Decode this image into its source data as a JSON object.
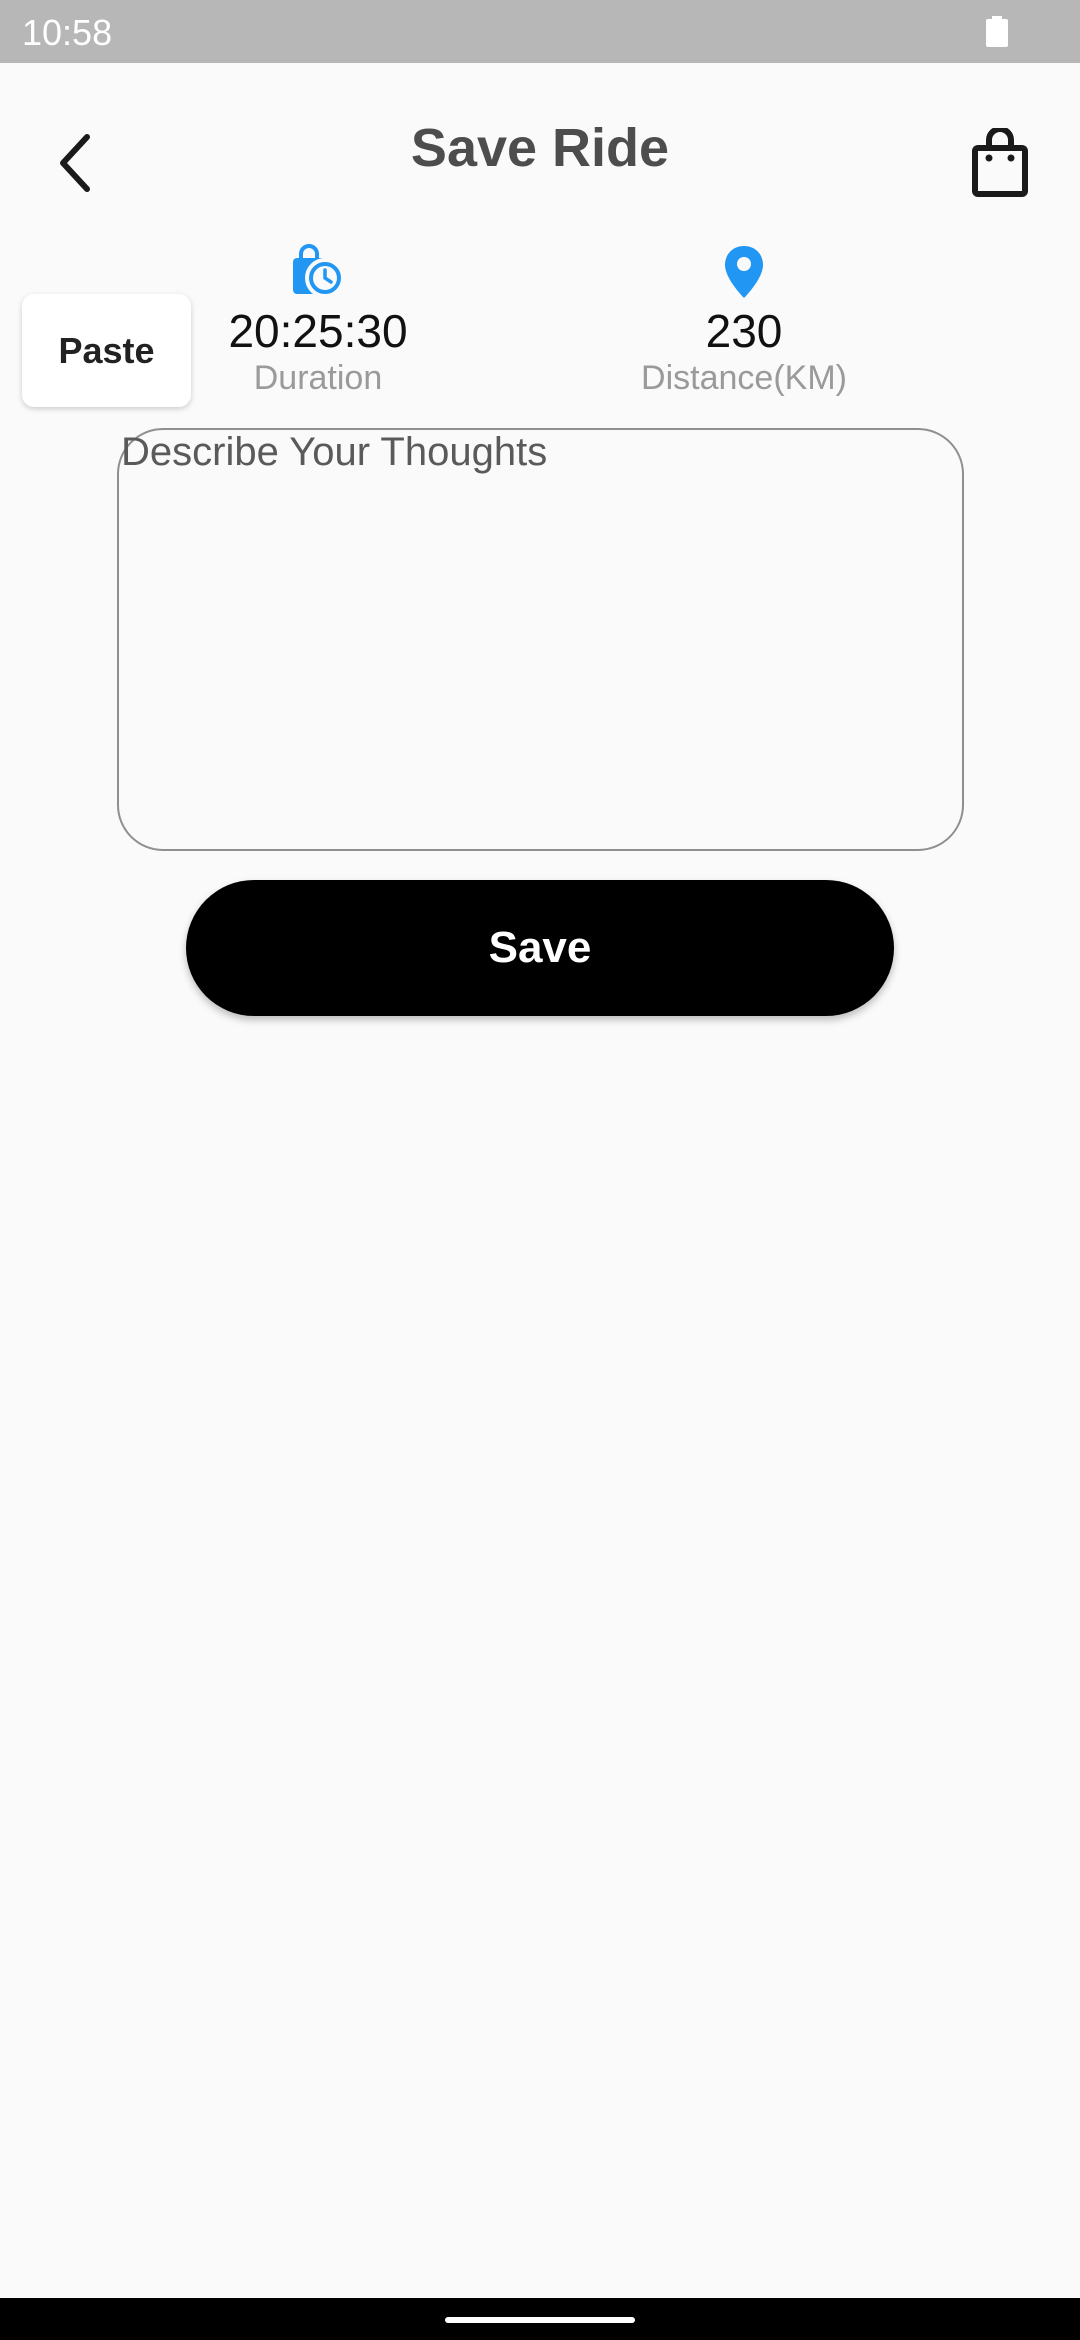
{
  "status_bar": {
    "time": "10:58",
    "battery_icon": "battery-full-icon"
  },
  "header": {
    "title": "Save Ride",
    "back_icon": "chevron-left-icon",
    "bag_icon": "shopping-bag-icon"
  },
  "toolbar": {
    "paste_label": "Paste"
  },
  "stats": {
    "duration": {
      "value": "20:25:30",
      "label": "Duration",
      "icon": "clock-bag-icon"
    },
    "distance": {
      "value": "230",
      "label": "Distance(KM)",
      "icon": "location-pin-icon"
    }
  },
  "thoughts": {
    "placeholder": "Describe Your Thoughts",
    "value": ""
  },
  "actions": {
    "save_label": "Save"
  },
  "colors": {
    "accent": "#2196f3",
    "button": "#000000",
    "status_bar": "#b7b7b7",
    "background": "#fafafa"
  }
}
